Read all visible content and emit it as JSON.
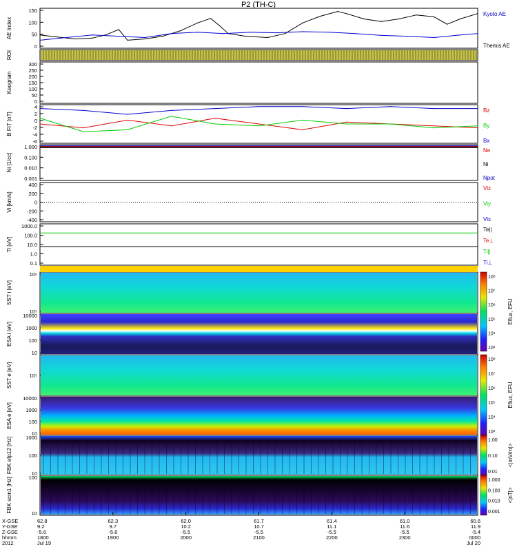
{
  "chart_data": {
    "type": "line",
    "title": "P2 (TH-C)",
    "panels": [
      {
        "id": "ae",
        "ylabel": "AE Index",
        "ylim": [
          0,
          150
        ],
        "yticks": [
          "150",
          "100",
          "50",
          "0"
        ],
        "legend": [
          {
            "name": "Kyoto AE",
            "color": "#0000cc"
          },
          {
            "name": "Themis AE",
            "color": "#000000"
          }
        ],
        "series": [
          {
            "name": "Kyoto AE",
            "color": "#000000",
            "x": [
              0,
              0.04,
              0.08,
              0.12,
              0.15,
              0.18,
              0.2,
              0.24,
              0.28,
              0.32,
              0.36,
              0.39,
              0.41,
              0.43,
              0.47,
              0.52,
              0.56,
              0.6,
              0.64,
              0.68,
              0.7,
              0.74,
              0.78,
              0.82,
              0.86,
              0.9,
              0.93,
              0.96,
              1
            ],
            "values": [
              50,
              42,
              35,
              38,
              50,
              70,
              30,
              35,
              45,
              65,
              95,
              112,
              85,
              55,
              45,
              40,
              55,
              95,
              120,
              138,
              130,
              110,
              100,
              110,
              125,
              118,
              90,
              110,
              130
            ]
          },
          {
            "name": "Themis AE",
            "color": "#0000cc",
            "x": [
              0,
              0.06,
              0.12,
              0.18,
              0.24,
              0.3,
              0.36,
              0.42,
              0.48,
              0.54,
              0.6,
              0.66,
              0.72,
              0.78,
              0.84,
              0.9,
              0.96,
              1
            ],
            "values": [
              30,
              40,
              50,
              45,
              40,
              55,
              60,
              55,
              60,
              58,
              62,
              60,
              55,
              48,
              45,
              40,
              50,
              55
            ]
          }
        ]
      },
      {
        "id": "roi",
        "ylabel": "ROI"
      },
      {
        "id": "keogram",
        "ylabel": "Keogram",
        "yticks": [
          "300",
          "250",
          "200",
          "150",
          "100",
          "50",
          "0"
        ]
      },
      {
        "id": "bfield",
        "ylabel": "B FIT [nT]",
        "ylim": [
          -6,
          4
        ],
        "yticks": [
          "4",
          "2",
          "0",
          "-2",
          "-4",
          "-6"
        ],
        "legend": [
          {
            "name": "Bz",
            "color": "#dd0000"
          },
          {
            "name": "By",
            "color": "#00cc00"
          },
          {
            "name": "Bx",
            "color": "#0000cc"
          }
        ],
        "series": [
          {
            "name": "Bz",
            "color": "#0000cc",
            "x": [
              0,
              0.1,
              0.2,
              0.3,
              0.4,
              0.5,
              0.6,
              0.7,
              0.8,
              0.9,
              1
            ],
            "values": [
              3,
              2.5,
              1.5,
              2.5,
              3,
              3.5,
              3.5,
              3,
              3.5,
              3,
              3
            ]
          },
          {
            "name": "By",
            "color": "#dd0000",
            "x": [
              0,
              0.1,
              0.2,
              0.3,
              0.4,
              0.5,
              0.6,
              0.7,
              0.8,
              0.9,
              1
            ],
            "values": [
              -1,
              -2,
              0,
              -1.5,
              0.5,
              -1,
              -2.5,
              -0.5,
              -1,
              -1.5,
              -2
            ]
          },
          {
            "name": "Bx",
            "color": "#00cc00",
            "x": [
              0,
              0.1,
              0.2,
              0.3,
              0.4,
              0.5,
              0.6,
              0.7,
              0.8,
              0.9,
              1
            ],
            "values": [
              0.5,
              -3,
              -2.5,
              1,
              -1,
              -1.5,
              0,
              -1,
              -1,
              -2,
              -1.5
            ]
          }
        ]
      },
      {
        "id": "density",
        "ylabel": "Ni [1/cc]",
        "yticks": [
          "1.000",
          "0.100",
          "0.010",
          "0.001"
        ],
        "legend": [
          {
            "name": "Ne",
            "color": "#dd0000"
          },
          {
            "name": "Ni",
            "color": "#000000"
          },
          {
            "name": "Npot",
            "color": "#0000cc"
          }
        ]
      },
      {
        "id": "velocity",
        "ylabel": "Vi [km/s]",
        "ylim": [
          -400,
          400
        ],
        "yticks": [
          "400",
          "200",
          "0",
          "-200",
          "-400"
        ],
        "legend": [
          {
            "name": "Viz",
            "color": "#dd0000"
          },
          {
            "name": "Viy",
            "color": "#00cc00"
          },
          {
            "name": "Vix",
            "color": "#0000cc"
          }
        ]
      },
      {
        "id": "temperature",
        "ylabel": "Ti [eV]",
        "yticks": [
          "1000.0",
          "100.0",
          "10.0",
          "1.0",
          "0.1"
        ],
        "legend": [
          {
            "name": "Te||",
            "color": "#000000"
          },
          {
            "name": "Te⊥",
            "color": "#dd0000"
          },
          {
            "name": "Ti||",
            "color": "#00cc00"
          },
          {
            "name": "Ti⊥",
            "color": "#0000cc"
          }
        ]
      },
      {
        "id": "sst_ion",
        "ylabel": "SST i [eV]",
        "yticks": [
          "10⁶",
          "10⁵"
        ]
      },
      {
        "id": "esa_ion",
        "ylabel": "ESA i [eV]",
        "yticks": [
          "10000",
          "1000",
          "100",
          "10"
        ]
      },
      {
        "id": "sst_e",
        "ylabel": "SST e [eV]",
        "yticks": [
          "10⁵"
        ]
      },
      {
        "id": "esa_e",
        "ylabel": "ESA e [eV]",
        "yticks": [
          "10000",
          "1000",
          "100",
          "10"
        ]
      },
      {
        "id": "fbk_e",
        "ylabel": "FBK efp12 [Hz]",
        "yticks": [
          "1000",
          "100",
          "10"
        ]
      },
      {
        "id": "fbk_b",
        "ylabel": "FBK scm1 [Hz]",
        "yticks": [
          "100",
          "10"
        ]
      }
    ],
    "colorbars": [
      {
        "label": "Eflux, EFU",
        "ticks": [
          "10⁸",
          "10⁷",
          "10⁶",
          "10⁵",
          "10⁴",
          "10³"
        ]
      },
      {
        "label": "Eflux, EFU",
        "ticks": [
          "10⁸",
          "10⁷",
          "10⁶",
          "10⁵",
          "10⁴",
          "10³"
        ]
      },
      {
        "label": "<|mV/m|>",
        "ticks": [
          "1.00",
          "0.10",
          "0.01"
        ]
      },
      {
        "label": "<|nT|>",
        "ticks": [
          "1.000",
          "0.100",
          "0.010",
          "0.001"
        ]
      }
    ],
    "x_axis": {
      "row_labels": [
        "X-GSE",
        "Y-GSE",
        "Z-GSE",
        "hhmm",
        "2012"
      ],
      "columns": [
        [
          "62.8",
          "9.2",
          "-5.6",
          "1800",
          "Jul 19"
        ],
        [
          "62.3",
          "9.7",
          "-5.6",
          "1900",
          ""
        ],
        [
          "62.0",
          "10.2",
          "-5.5",
          "2000",
          ""
        ],
        [
          "61.7",
          "10.7",
          "-5.5",
          "2100",
          ""
        ],
        [
          "61.4",
          "11.1",
          "-5.5",
          "2200",
          ""
        ],
        [
          "61.0",
          "11.6",
          "-5.5",
          "2300",
          ""
        ],
        [
          "60.6",
          "11.9",
          "-5.4",
          "0000",
          "Jul 20"
        ]
      ]
    }
  }
}
